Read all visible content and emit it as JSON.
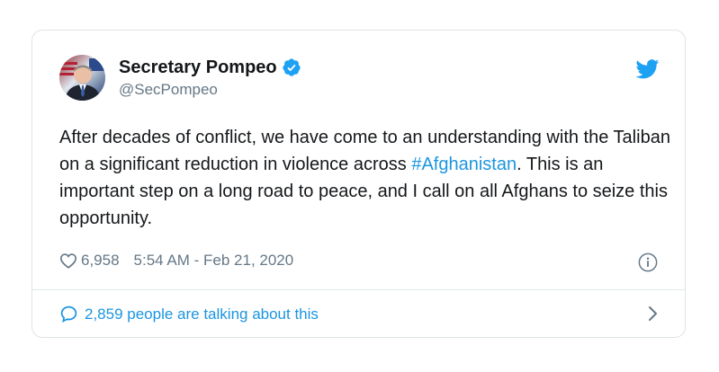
{
  "tweet": {
    "author": {
      "display_name": "Secretary Pompeo",
      "handle": "@SecPompeo",
      "verified_icon": "verified-badge-icon",
      "avatar_icon": "profile-photo"
    },
    "text": {
      "part1": "After decades of conflict, we have come to an understanding with the Taliban on a significant reduction in violence across ",
      "hashtag": "#Afghanistan",
      "part2": ". This is an important step on a long road to peace, and I call on all Afghans to seize this opportunity."
    },
    "likes": "6,958",
    "timestamp": "5:54 AM - Feb 21, 2020",
    "conversation_label": "2,859 people are talking about this"
  },
  "colors": {
    "accent": "#1b95e0",
    "twitter_blue": "#1da1f2",
    "text": "#14171a",
    "muted": "#657786",
    "border": "#dfe3e7"
  },
  "icons": {
    "brand": "twitter-bird-icon",
    "like": "heart-icon",
    "info": "info-icon",
    "reply": "speech-bubble-icon",
    "more": "chevron-right-icon"
  }
}
